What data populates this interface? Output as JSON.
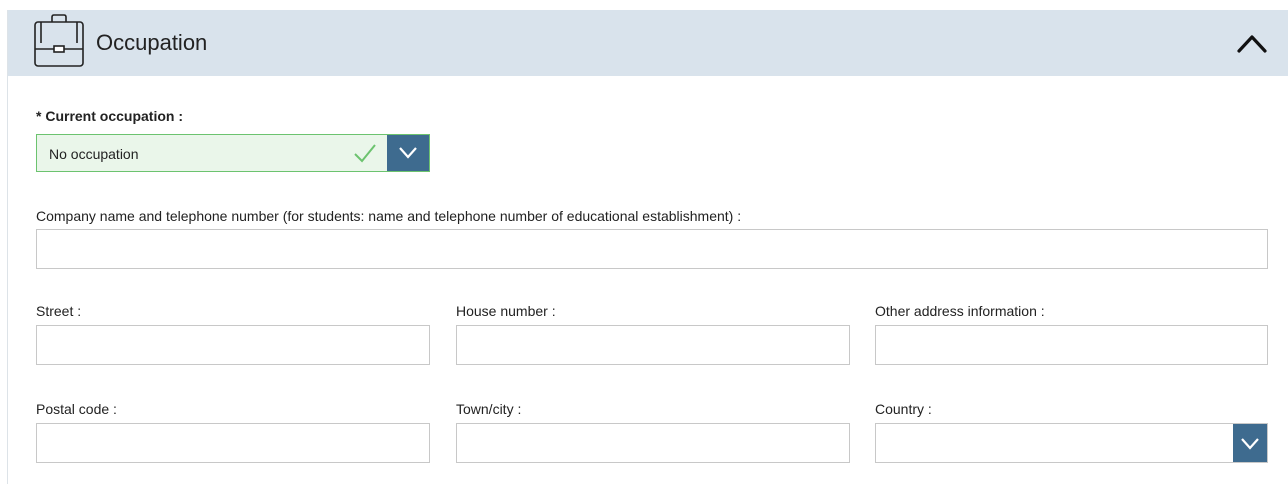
{
  "section": {
    "title": "Occupation",
    "icon": "briefcase-icon",
    "collapse_icon": "chevron-up-icon"
  },
  "occupation": {
    "label": "* Current occupation :",
    "selected": "No occupation",
    "valid_icon": "checkmark-icon",
    "dropdown_icon": "chevron-down-icon"
  },
  "company": {
    "label": "Company name and telephone number (for students: name and telephone number of educational establishment) :",
    "value": ""
  },
  "street": {
    "label": "Street :",
    "value": ""
  },
  "house_number": {
    "label": "House number :",
    "value": ""
  },
  "other_address": {
    "label": "Other address information :",
    "value": ""
  },
  "postal_code": {
    "label": "Postal code :",
    "value": ""
  },
  "town": {
    "label": "Town/city :",
    "value": ""
  },
  "country": {
    "label": "Country :",
    "selected": "",
    "dropdown_icon": "chevron-down-icon"
  },
  "colors": {
    "header_bg": "#d9e3ec",
    "accent": "#3e6b8f",
    "valid_border": "#6cc36f",
    "valid_bg": "#eaf6ea",
    "field_border": "#c8c8c8"
  }
}
